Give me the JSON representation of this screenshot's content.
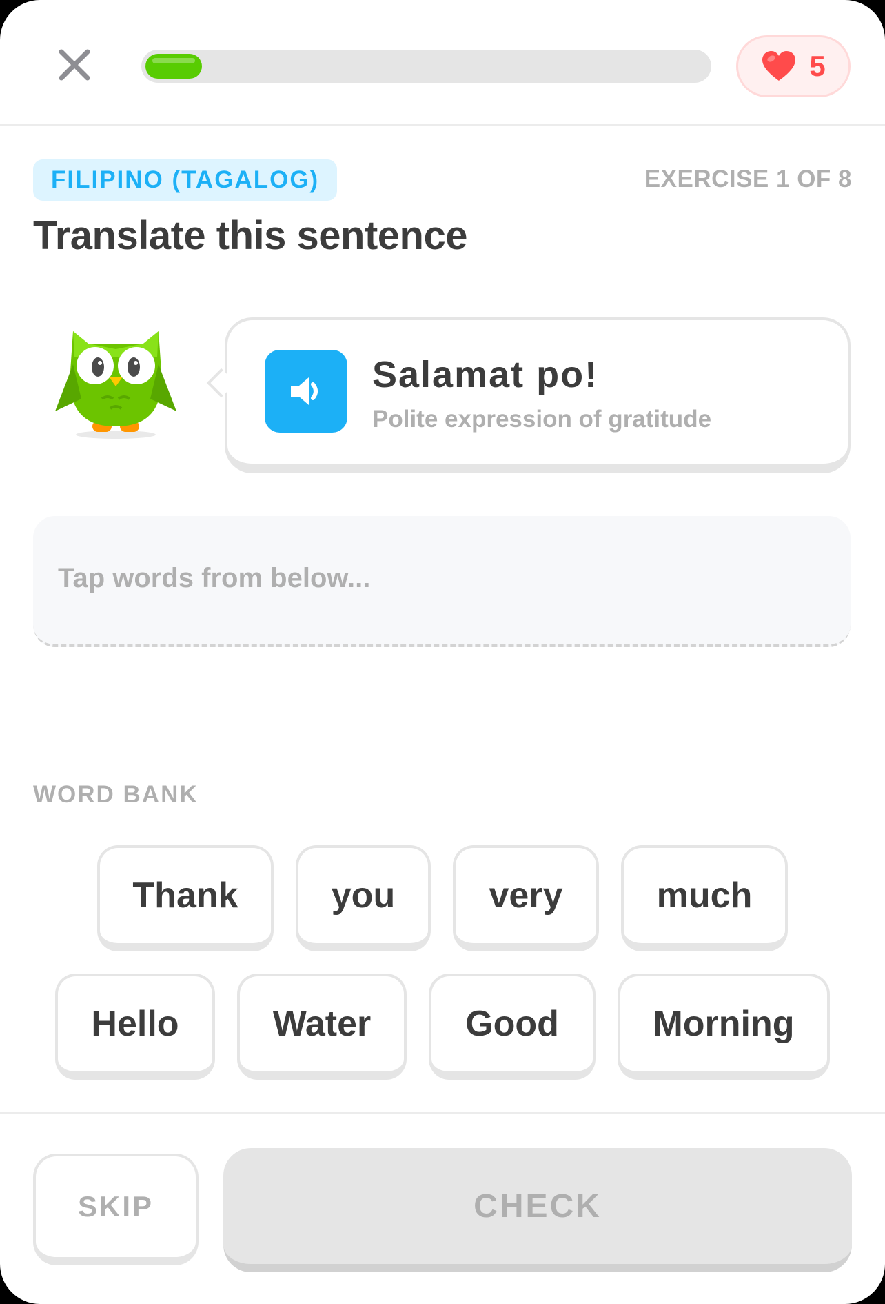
{
  "header": {
    "close_icon": "close-icon",
    "progress": {
      "fraction": 0.1
    },
    "hearts": {
      "icon": "heart-icon",
      "count": "5",
      "color": "#ff4b4b"
    }
  },
  "exercise": {
    "language": "FILIPINO (TAGALOG)",
    "counter": "EXERCISE 1 OF 8",
    "title": "Translate this sentence"
  },
  "prompt": {
    "mascot": "owl-mascot",
    "speaker_icon": "speaker-icon",
    "phrase": "Salamat po!",
    "hint": "Polite expression of gratitude"
  },
  "answer": {
    "placeholder": "Tap words from below..."
  },
  "word_bank": {
    "label": "WORD BANK",
    "row1": [
      {
        "label": "Thank"
      },
      {
        "label": "you"
      },
      {
        "label": "very"
      },
      {
        "label": "much"
      }
    ],
    "row2": [
      {
        "label": "Hello"
      },
      {
        "label": "Water"
      },
      {
        "label": "Good"
      },
      {
        "label": "Morning"
      }
    ]
  },
  "footer": {
    "skip_label": "SKIP",
    "check_label": "CHECK"
  },
  "colors": {
    "accent_green": "#58cc02",
    "accent_blue": "#1cb0f6",
    "heart_red": "#ff4b4b"
  }
}
